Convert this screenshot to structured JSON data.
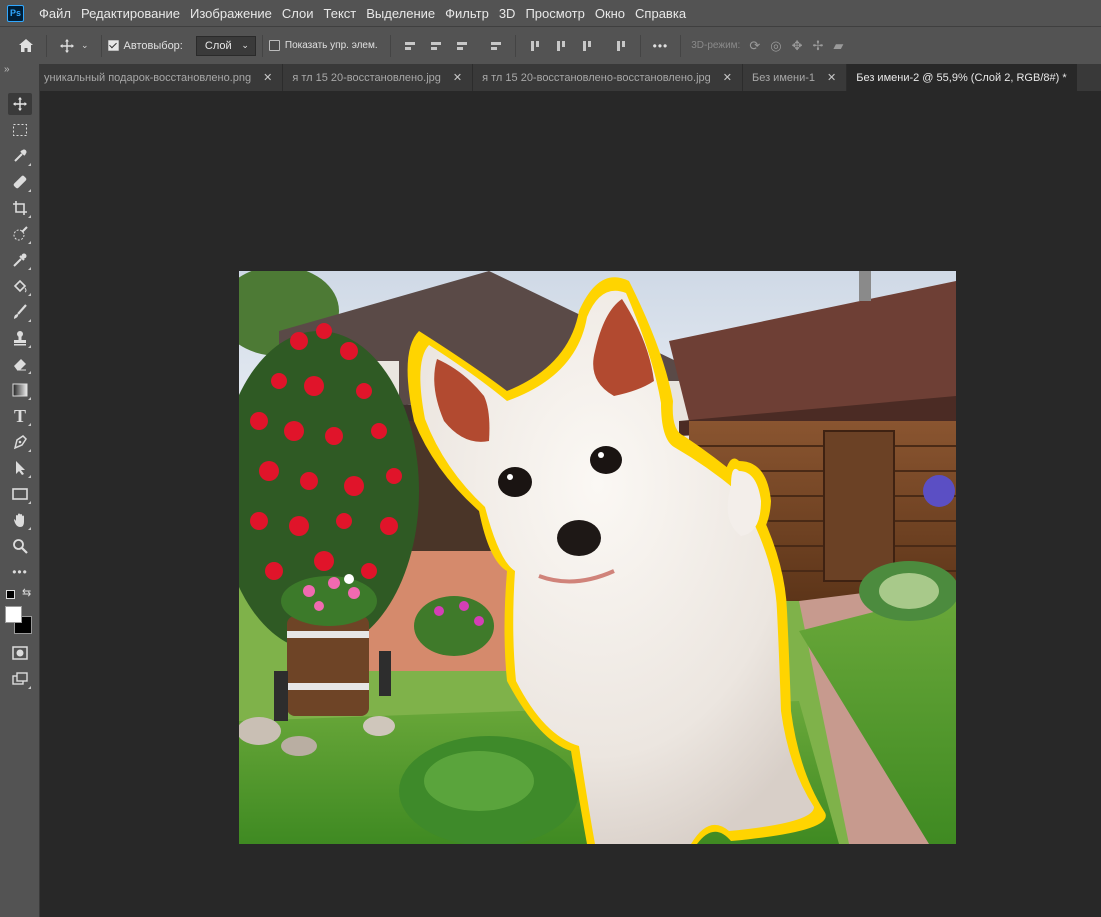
{
  "app": {
    "logo_text": "Ps",
    "menu": [
      "Файл",
      "Редактирование",
      "Изображение",
      "Слои",
      "Текст",
      "Выделение",
      "Фильтр",
      "3D",
      "Просмотр",
      "Окно",
      "Справка"
    ]
  },
  "options": {
    "autoselect_label": "Автовыбор:",
    "autoselect_value": "Слой",
    "show_controls_label": "Показать упр. элем.",
    "more_label": "•••",
    "mode3d_label": "3D-режим:"
  },
  "toolbar": {
    "collapse_label": "»",
    "more_tools_label": "•••"
  },
  "tabs": [
    {
      "label": "уникальный подарок-восстановлено.png",
      "active": false
    },
    {
      "label": "я тл 15 20-восстановлено.jpg",
      "active": false
    },
    {
      "label": "я тл 15 20-восстановлено-восстановлено.jpg",
      "active": false
    },
    {
      "label": "Без имени-1",
      "active": false
    },
    {
      "label": "Без имени-2 @ 55,9% (Слой 2, RGB/8#) *",
      "active": true
    }
  ],
  "colors": {
    "foreground": "#ffffff",
    "background": "#000000",
    "dog_outline": "#ffd400",
    "accent_ps": "#31a8ff"
  }
}
